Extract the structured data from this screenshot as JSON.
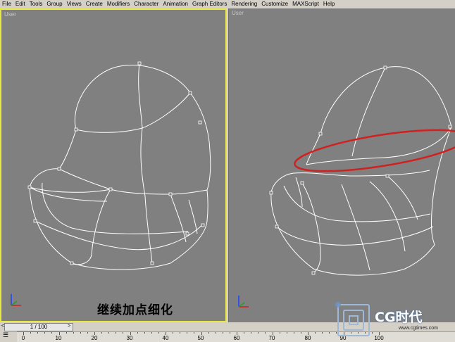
{
  "menu": {
    "items": [
      "File",
      "Edit",
      "Tools",
      "Group",
      "Views",
      "Create",
      "Modifiers",
      "Character",
      "Animation",
      "Graph Editors",
      "Rendering",
      "Customize",
      "MAXScript",
      "Help"
    ]
  },
  "viewports": {
    "left": {
      "label": "User",
      "active": true
    },
    "right": {
      "label": "User",
      "active": false
    }
  },
  "caption": "继续加点细化",
  "timeslider": {
    "label": "1 / 100",
    "prev": "<",
    "next": ">"
  },
  "ruler": {
    "ticks": [
      "0",
      "10",
      "20",
      "30",
      "40",
      "50",
      "60",
      "70",
      "80",
      "90",
      "100"
    ]
  },
  "logo": {
    "text": "CG时代",
    "url": "www.cgtimes.com"
  },
  "colors": {
    "viewport_bg": "#808080",
    "active_border": "#e8e840",
    "annotation": "#d02020",
    "wire": "#ffffff"
  }
}
